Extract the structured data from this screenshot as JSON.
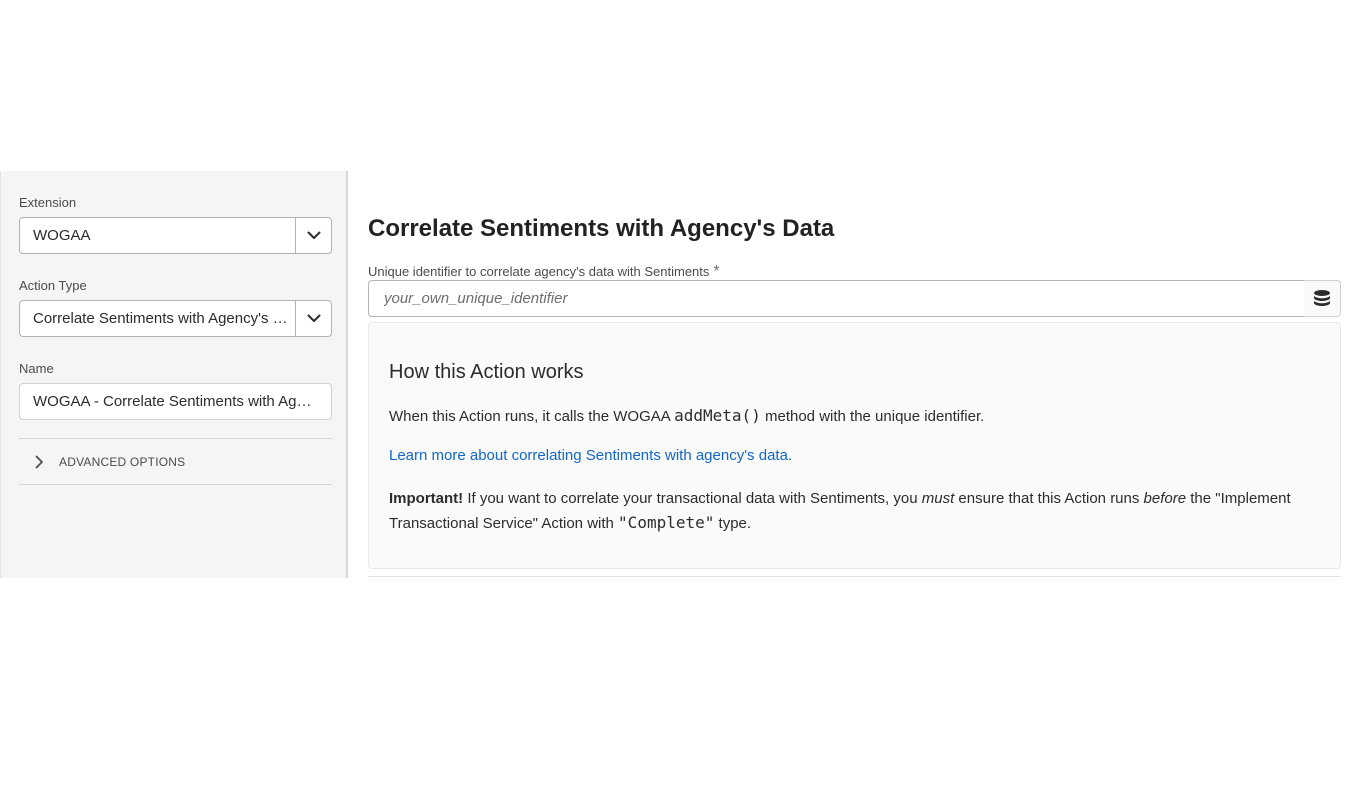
{
  "sidebar": {
    "extension_label": "Extension",
    "extension_value": "WOGAA",
    "action_type_label": "Action Type",
    "action_type_value": "Correlate Sentiments with Agency's Data",
    "name_label": "Name",
    "name_value": "WOGAA - Correlate Sentiments with Agency's Data",
    "advanced_options_label": "ADVANCED OPTIONS"
  },
  "main": {
    "title": "Correlate Sentiments with Agency's Data",
    "identifier_label": "Unique identifier to correlate agency's data with Sentiments",
    "identifier_required_mark": "*",
    "identifier_placeholder": "your_own_unique_identifier",
    "identifier_value": "",
    "info": {
      "heading": "How this Action works",
      "line1_before": "When this Action runs, it calls the WOGAA ",
      "line1_code": "addMeta()",
      "line1_after": " method with the unique identifier.",
      "link_text": "Learn more about correlating Sentiments with agency's data.",
      "important_label": "Important!",
      "important_part1": " If you want to correlate your transactional data with Sentiments, you ",
      "important_em1": "must",
      "important_part2": " ensure that this Action runs ",
      "important_em2": "before",
      "important_part3": " the \"Implement Transactional Service\" Action with ",
      "important_code": "\"Complete\"",
      "important_part4": " type."
    }
  },
  "icons": {
    "picker_chevron": "chevron-down-icon",
    "advanced_chevron": "chevron-right-icon",
    "data_element": "database-icon"
  }
}
